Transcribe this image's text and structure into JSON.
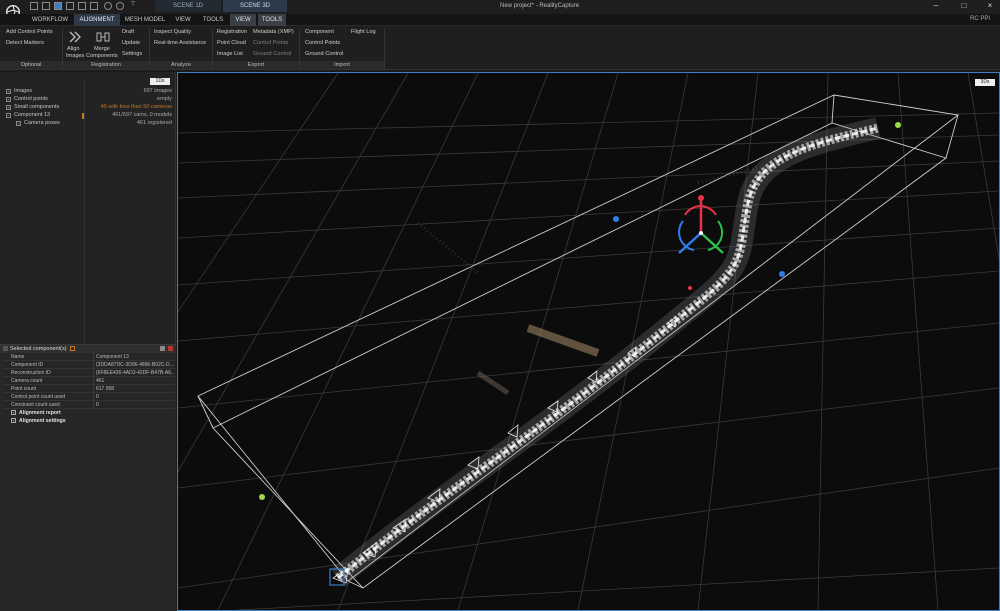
{
  "window": {
    "title": "New project* - RealityCapture",
    "rc_ppi": "RC PPI"
  },
  "scene_tabs": [
    "SCENE 1D",
    "SCENE 3D"
  ],
  "menu": [
    "WORKFLOW",
    "ALIGNMENT",
    "MESH MODEL",
    "VIEW",
    "TOOLS",
    "VIEW",
    "TOOLS"
  ],
  "ribbon": {
    "optional": {
      "label": "Optional",
      "items": [
        "Add Control Points",
        "Detect Markers"
      ]
    },
    "registration": {
      "label": "Registration",
      "align": [
        "Align",
        "Images"
      ],
      "merge": [
        "Merge",
        "Components"
      ],
      "items": [
        "Draft",
        "Update",
        "Settings"
      ]
    },
    "analyze": {
      "label": "Analyze",
      "items": [
        "Inspect Quality",
        "Real-time Assistance"
      ]
    },
    "export": {
      "label": "Export",
      "col1": [
        "Registration",
        "Point Cloud",
        "Image List"
      ],
      "col2": [
        "Metadata (XMP)",
        "Control Points",
        "Ground Control"
      ]
    },
    "import": {
      "label": "Import",
      "col1": [
        "Component",
        "Control Points",
        "Ground Control"
      ],
      "col2": [
        "Flight Log"
      ]
    }
  },
  "tree": {
    "badge": "1Ds",
    "rows": [
      {
        "label": "Images",
        "value": "697 images"
      },
      {
        "label": "Control points",
        "value": "empty"
      },
      {
        "label": "Small components",
        "value": "45 with less than 50 cameras"
      },
      {
        "label": "Component 13",
        "value": "461/697 cams, 0 models"
      },
      {
        "label": "Camera poses",
        "value": "461 registered"
      }
    ]
  },
  "properties": {
    "title": "Selected component(s)",
    "rows": [
      {
        "key": "Name",
        "value": "Component 13"
      },
      {
        "key": "Component ID",
        "value": "{3DDA87DC-3D96-4896-B02C-D..."
      },
      {
        "key": "Reconstruction ID",
        "value": "{6F8EE426-4AD3-42DF-B47B-A6..."
      },
      {
        "key": "Camera count",
        "value": "461"
      },
      {
        "key": "Point count",
        "value": "617 958"
      },
      {
        "key": "Control point count used",
        "value": "0"
      },
      {
        "key": "Constraint count used",
        "value": "0"
      }
    ],
    "sections": [
      "Alignment report",
      "Alignment settings"
    ]
  },
  "viewport": {
    "badge": "3Ds"
  },
  "colors": {
    "accent": "#3b7fc4",
    "warning": "#c27a2a",
    "gizmo_x": "#e8344a",
    "gizmo_y": "#2fbf4a",
    "gizmo_z": "#2f7ee8"
  }
}
